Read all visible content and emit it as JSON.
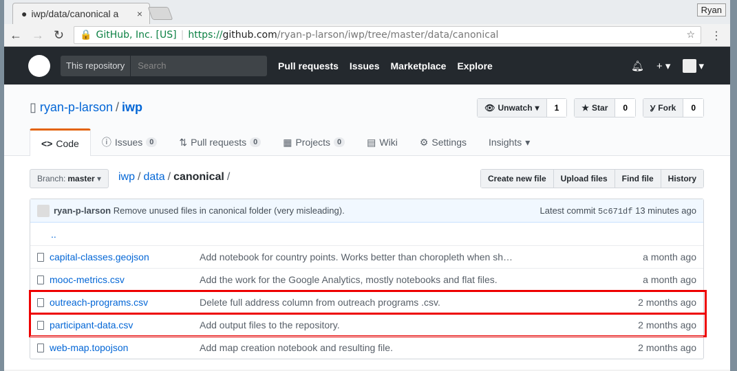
{
  "browser": {
    "tab_title": "iwp/data/canonical a",
    "user": "Ryan",
    "security": "GitHub, Inc. [US]",
    "url_scheme": "https://",
    "url_host": "github.com",
    "url_path": "/ryan-p-larson/iwp/tree/master/data/canonical"
  },
  "header": {
    "scope": "This repository",
    "search_placeholder": "Search",
    "nav": [
      "Pull requests",
      "Issues",
      "Marketplace",
      "Explore"
    ]
  },
  "repo": {
    "owner": "ryan-p-larson",
    "name": "iwp",
    "watch": "Unwatch",
    "watch_count": "1",
    "star": "Star",
    "star_count": "0",
    "fork": "Fork",
    "fork_count": "0",
    "tabs": [
      {
        "label": "Code"
      },
      {
        "label": "Issues",
        "count": "0"
      },
      {
        "label": "Pull requests",
        "count": "0"
      },
      {
        "label": "Projects",
        "count": "0"
      },
      {
        "label": "Wiki"
      },
      {
        "label": "Settings"
      },
      {
        "label": "Insights"
      }
    ]
  },
  "toolbar": {
    "branch_label": "Branch:",
    "branch": "master",
    "crumbs": [
      "iwp",
      "data",
      "canonical"
    ],
    "create": "Create new file",
    "upload": "Upload files",
    "find": "Find file",
    "history": "History"
  },
  "commit": {
    "author": "ryan-p-larson",
    "message": "Remove unused files in canonical folder (very misleading).",
    "latest": "Latest commit",
    "sha": "5c671df",
    "time": "13 minutes ago"
  },
  "files": [
    {
      "name": "..",
      "message": "",
      "time": ""
    },
    {
      "name": "capital-classes.geojson",
      "message": "Add notebook for country points. Works better than choropleth when sh…",
      "time": "a month ago"
    },
    {
      "name": "mooc-metrics.csv",
      "message": "Add the work for the Google Analytics, mostly notebooks and flat files.",
      "time": "a month ago"
    },
    {
      "name": "outreach-programs.csv",
      "message": "Delete full address column from outreach programs .csv.",
      "time": "2 months ago",
      "highlighted": true
    },
    {
      "name": "participant-data.csv",
      "message": "Add output files to the repository.",
      "time": "2 months ago",
      "highlighted": true
    },
    {
      "name": "web-map.topojson",
      "message": "Add map creation notebook and resulting file.",
      "time": "2 months ago"
    }
  ]
}
